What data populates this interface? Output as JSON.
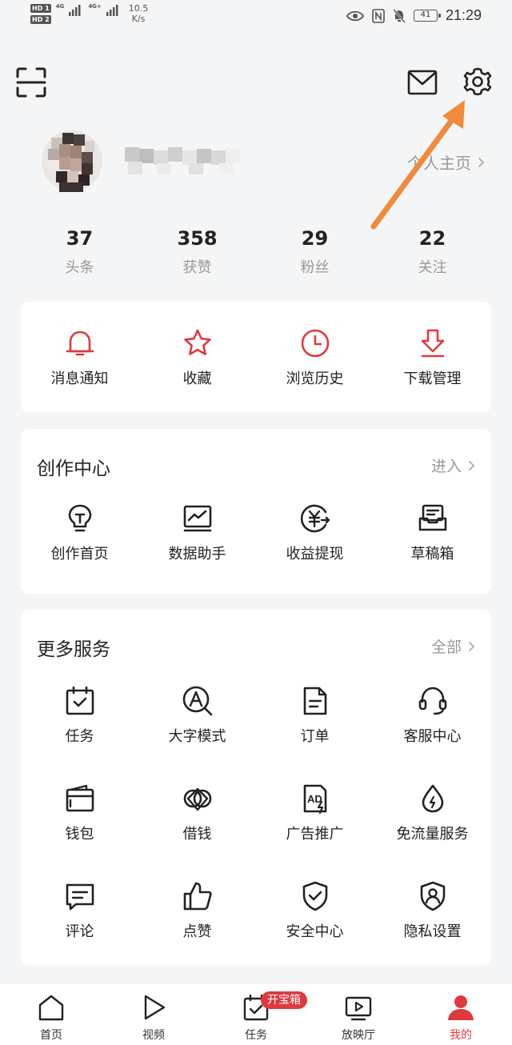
{
  "status_bar": {
    "hd1": "HD 1",
    "hd2": "HD 2",
    "signal1": "4G",
    "signal2": "4G+",
    "net_speed_value": "10.5",
    "net_speed_unit": "K/s",
    "battery": "41",
    "time": "21:29"
  },
  "header": {
    "scan_icon": "scan-icon",
    "mail_icon": "mail-icon",
    "settings_icon": "gear-icon"
  },
  "profile": {
    "link_label": "个人主页"
  },
  "stats": [
    {
      "value": "37",
      "label": "头条"
    },
    {
      "value": "358",
      "label": "获赞"
    },
    {
      "value": "29",
      "label": "粉丝"
    },
    {
      "value": "22",
      "label": "关注"
    }
  ],
  "quick_actions": [
    {
      "label": "消息通知",
      "icon": "bell-icon"
    },
    {
      "label": "收藏",
      "icon": "star-icon"
    },
    {
      "label": "浏览历史",
      "icon": "clock-icon"
    },
    {
      "label": "下载管理",
      "icon": "download-icon"
    }
  ],
  "creator_center": {
    "title": "创作中心",
    "link": "进入",
    "items": [
      {
        "label": "创作首页",
        "icon": "lightbulb-icon"
      },
      {
        "label": "数据助手",
        "icon": "chart-monitor-icon"
      },
      {
        "label": "收益提现",
        "icon": "yuan-icon"
      },
      {
        "label": "草稿箱",
        "icon": "drafts-icon"
      }
    ]
  },
  "more_services": {
    "title": "更多服务",
    "link": "全部",
    "items": [
      {
        "label": "任务",
        "icon": "calendar-check-icon"
      },
      {
        "label": "大字模式",
        "icon": "font-size-icon"
      },
      {
        "label": "订单",
        "icon": "document-icon"
      },
      {
        "label": "客服中心",
        "icon": "headset-icon"
      },
      {
        "label": "钱包",
        "icon": "wallet-icon"
      },
      {
        "label": "借钱",
        "icon": "loan-icon"
      },
      {
        "label": "广告推广",
        "icon": "ad-icon"
      },
      {
        "label": "免流量服务",
        "icon": "data-drop-icon"
      },
      {
        "label": "评论",
        "icon": "comment-icon"
      },
      {
        "label": "点赞",
        "icon": "thumbs-up-icon"
      },
      {
        "label": "安全中心",
        "icon": "shield-check-icon"
      },
      {
        "label": "隐私设置",
        "icon": "privacy-icon"
      }
    ],
    "ad_icon_text": "AD"
  },
  "bottom_nav": {
    "items": [
      {
        "label": "首页",
        "icon": "home-icon"
      },
      {
        "label": "视频",
        "icon": "play-icon"
      },
      {
        "label": "任务",
        "icon": "task-icon"
      },
      {
        "label": "放映厅",
        "icon": "tv-icon"
      },
      {
        "label": "我的",
        "icon": "user-icon"
      }
    ],
    "task_badge": "开宝箱",
    "active_index": 4
  },
  "colors": {
    "accent_red": "#e0393e",
    "annotation_arrow": "#f08a3c",
    "background": "#f4f5f6"
  }
}
